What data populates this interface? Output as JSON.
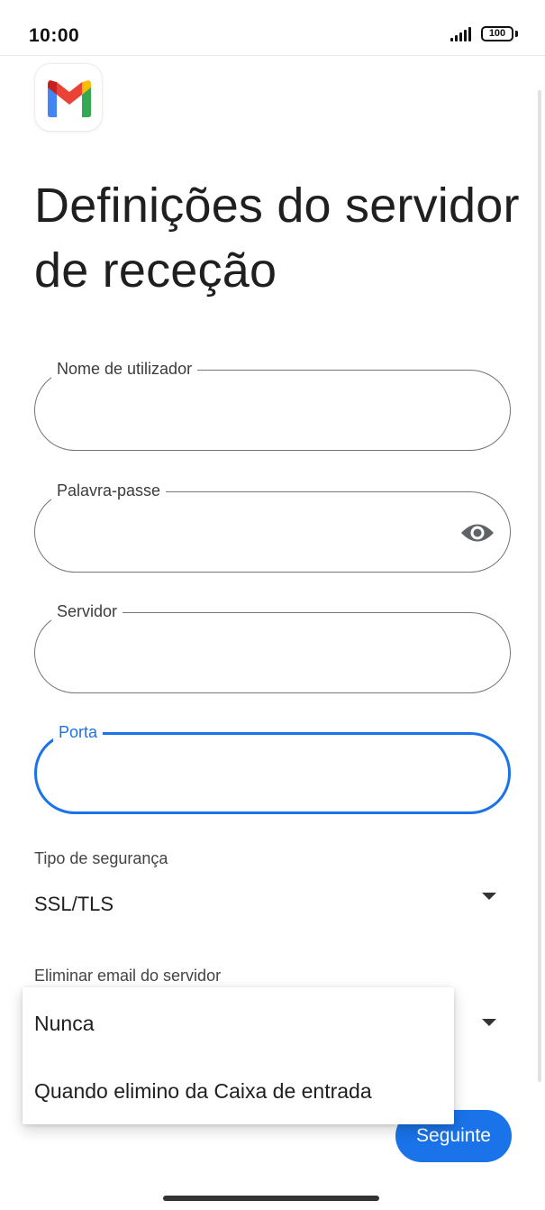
{
  "status_bar": {
    "time": "10:00",
    "battery": "100",
    "icons": [
      "signal-icon",
      "battery-icon"
    ]
  },
  "app": {
    "logo_icon": "gmail-logo",
    "brand_colors": [
      "#4285f4",
      "#ea4335",
      "#fbbc04",
      "#34a853",
      "#c5221f"
    ]
  },
  "title": "Definições do servidor de receção",
  "fields": [
    {
      "label": "Nome de utilizador",
      "value": "",
      "focused": false
    },
    {
      "label": "Palavra-passe",
      "value": "",
      "focused": false,
      "trailing_icon": "eye-icon"
    },
    {
      "label": "Servidor",
      "value": "",
      "focused": false
    },
    {
      "label": "Porta",
      "value": "",
      "focused": true
    }
  ],
  "security": {
    "label": "Tipo de segurança",
    "value": "SSL/TLS"
  },
  "delete_email": {
    "label": "Eliminar email do servidor",
    "options": [
      "Nunca",
      "Quando elimino da Caixa de entrada"
    ]
  },
  "next_button": "Seguinte",
  "colors": {
    "accent": "#1a73e8",
    "outline": "#757575"
  }
}
